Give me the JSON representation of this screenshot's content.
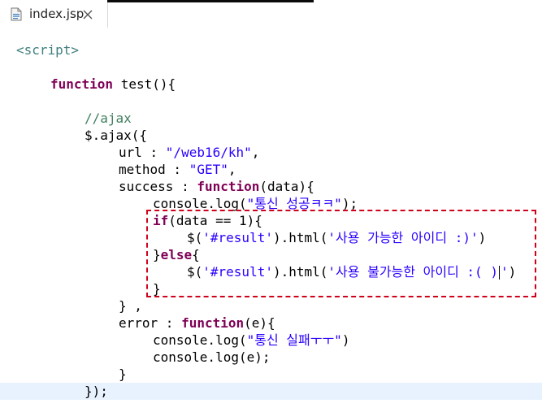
{
  "tab": {
    "label": "index.jsp",
    "icon": "jsp-file-icon",
    "close_icon": "close-icon"
  },
  "colors": {
    "keyword": "#7f0055",
    "string": "#2a00ff",
    "comment": "#3f7f5f",
    "tag": "#3f7f7f",
    "highlight_box": "#d0021b",
    "current_line": "#e8f2fe"
  },
  "code": {
    "l1": "<script>",
    "l2_kw": "function",
    "l2_rest": " test(){",
    "l3": "//ajax",
    "l4": "$.ajax({",
    "l5_a": "url : ",
    "l5_s": "\"/web16/kh\"",
    "l5_b": ",",
    "l6_a": "method : ",
    "l6_s": "\"GET\"",
    "l6_b": ",",
    "l7_a": "success : ",
    "l7_kw": "function",
    "l7_b": "(data){",
    "l8_a": "console.log(",
    "l8_s": "\"통신 성공ㅋㅋ\"",
    "l8_b": ");",
    "l9_kw": "if",
    "l9_b": "(data == 1){",
    "l10_a": "$(",
    "l10_s1": "'#result'",
    "l10_b": ").html(",
    "l10_s2": "'사용 가능한 아이디 :)'",
    "l10_c": ")",
    "l11_a": "}",
    "l11_kw": "else",
    "l11_b": "{",
    "l12_a": "$(",
    "l12_s1": "'#result'",
    "l12_b": ").html(",
    "l12_s2a": "'사용 불가능한 아이디 :( )",
    "l12_s2b": "'",
    "l12_c": ")",
    "l13": "}",
    "l14": "} ,",
    "l15_a": "error : ",
    "l15_kw": "function",
    "l15_b": "(e){",
    "l16_a": "console.log(",
    "l16_s": "\"통신 실패ㅜㅜ\"",
    "l16_b": ")",
    "l17": "console.log(e);",
    "l18": "}",
    "l19": "});"
  }
}
